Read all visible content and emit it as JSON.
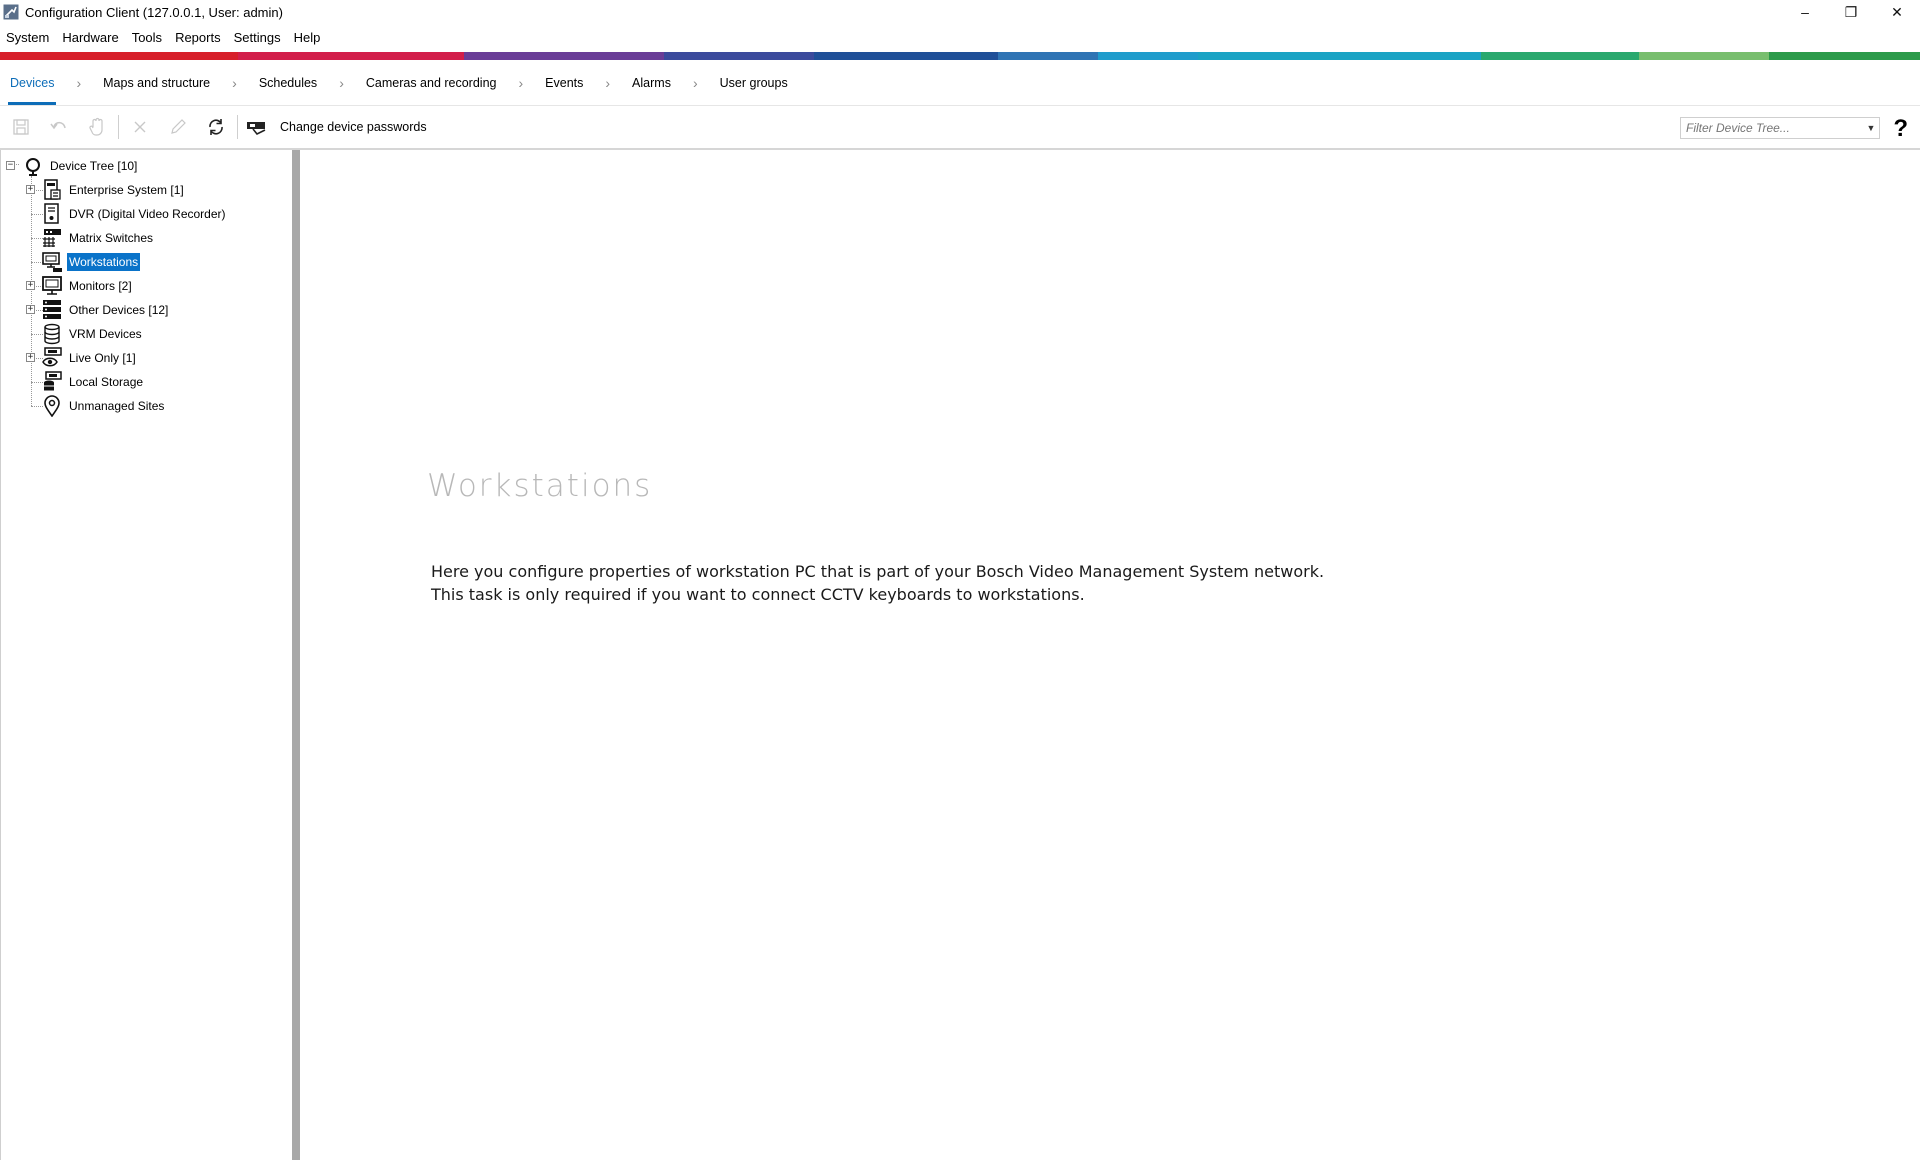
{
  "window": {
    "title": "Configuration Client (127.0.0.1, User: admin)",
    "minimize_glyph": "–",
    "restore_glyph": "❐",
    "close_glyph": "✕"
  },
  "menu": [
    "System",
    "Hardware",
    "Tools",
    "Reports",
    "Settings",
    "Help"
  ],
  "stripe_colors": [
    "#d71f2a",
    "#d21e4a",
    "#6a3d97",
    "#3b4a9c",
    "#1f4f98",
    "#2f74b4",
    "#1f9ccc",
    "#1aa3c4",
    "#2aa86e",
    "#78be6e",
    "#2c9a4a"
  ],
  "tabs": {
    "items": [
      "Devices",
      "Maps and structure",
      "Schedules",
      "Cameras and recording",
      "Events",
      "Alarms",
      "User groups"
    ],
    "separator": "›",
    "active": "Devices"
  },
  "toolbar": {
    "change_passwords_label": "Change device passwords",
    "filter_placeholder": "Filter Device Tree...",
    "help_label": "?"
  },
  "tree": {
    "root": "Device Tree [10]",
    "items": [
      {
        "label": "Enterprise System [1]",
        "icon": "enterprise-system-icon",
        "expandable": true
      },
      {
        "label": "DVR (Digital Video Recorder)",
        "icon": "dvr-icon",
        "expandable": false
      },
      {
        "label": "Matrix Switches",
        "icon": "matrix-switch-icon",
        "expandable": false
      },
      {
        "label": "Workstations",
        "icon": "workstation-icon",
        "expandable": false,
        "selected": true
      },
      {
        "label": "Monitors [2]",
        "icon": "monitor-icon",
        "expandable": true
      },
      {
        "label": "Other Devices [12]",
        "icon": "other-devices-icon",
        "expandable": true
      },
      {
        "label": "VRM Devices",
        "icon": "vrm-devices-icon",
        "expandable": false
      },
      {
        "label": "Live Only [1]",
        "icon": "live-only-icon",
        "expandable": true
      },
      {
        "label": "Local Storage",
        "icon": "local-storage-icon",
        "expandable": false
      },
      {
        "label": "Unmanaged Sites",
        "icon": "unmanaged-sites-icon",
        "expandable": false
      }
    ]
  },
  "content": {
    "heading": "Workstations",
    "line1": "Here you configure properties of workstation PC that is part of your Bosch Video Management System network.",
    "line2": "This task is only required if you want to connect CCTV keyboards to workstations."
  }
}
